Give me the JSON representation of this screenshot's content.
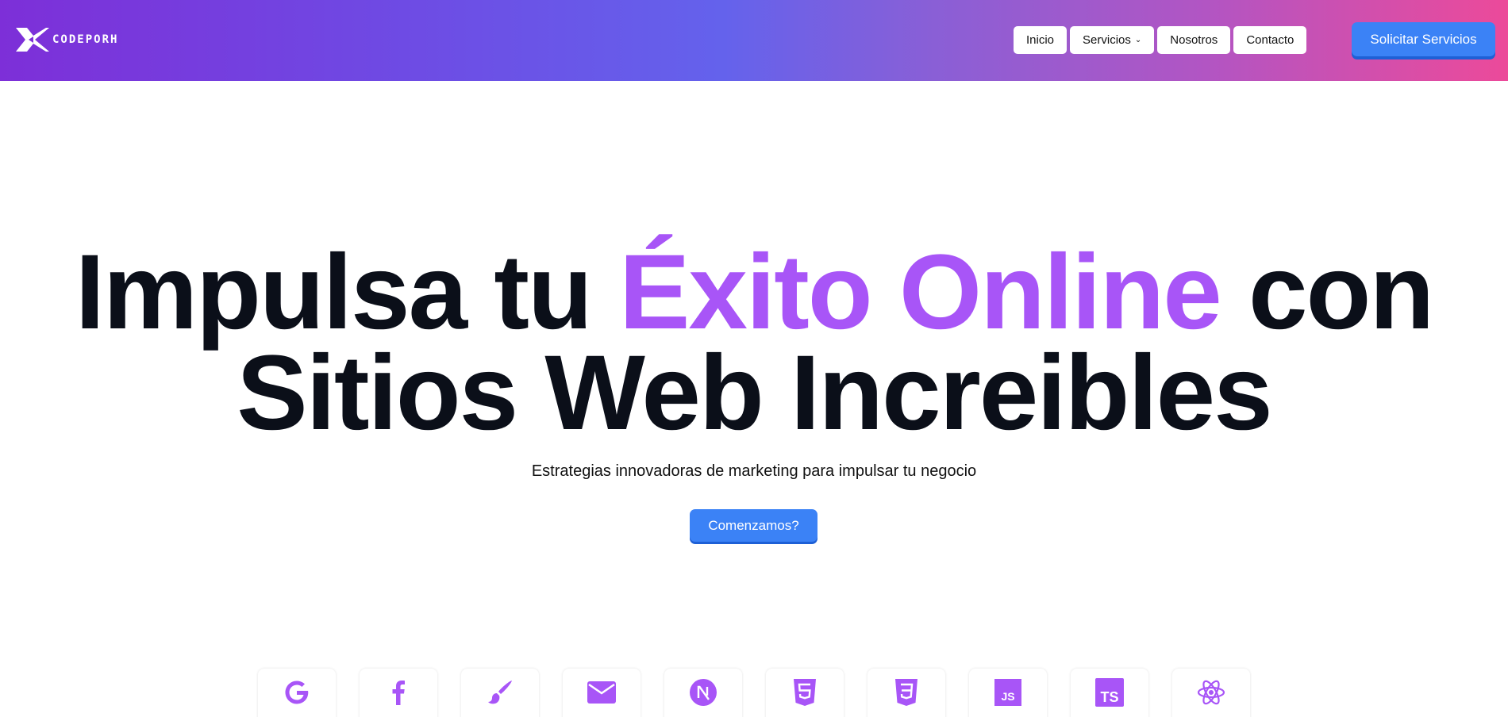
{
  "header": {
    "logo_text": "CODEPORH",
    "nav": [
      {
        "label": "Inicio"
      },
      {
        "label": "Servicios",
        "has_dropdown": true
      },
      {
        "label": "Nosotros"
      },
      {
        "label": "Contacto"
      }
    ],
    "cta": "Solicitar Servicios"
  },
  "hero": {
    "title_part1": "Impulsa tu ",
    "title_accent": "Éxito Online",
    "title_part2": " con",
    "title_line2": "Sitios Web Increibles",
    "subtitle": "Estrategias innovadoras de marketing para impulsar tu negocio",
    "button": "Comenzamos?"
  },
  "services": [
    {
      "icon": "google-icon",
      "label": ""
    },
    {
      "icon": "facebook-icon",
      "label": ""
    },
    {
      "icon": "paintbrush-icon",
      "label": ""
    },
    {
      "icon": "mail-icon",
      "label": ""
    },
    {
      "icon": "nextjs-icon",
      "label": ""
    },
    {
      "icon": "html5-icon",
      "label": ""
    },
    {
      "icon": "css3-icon",
      "label": ""
    },
    {
      "icon": "javascript-icon",
      "label": ""
    },
    {
      "icon": "typescript-icon",
      "label": ""
    },
    {
      "icon": "react-icon",
      "label": ""
    }
  ],
  "colors": {
    "accent_purple": "#a855f7",
    "button_blue": "#3b82f6",
    "icon_purple": "#a855f7",
    "header_gradient_start": "#7d2fd8",
    "header_gradient_end": "#ec4a9a"
  }
}
